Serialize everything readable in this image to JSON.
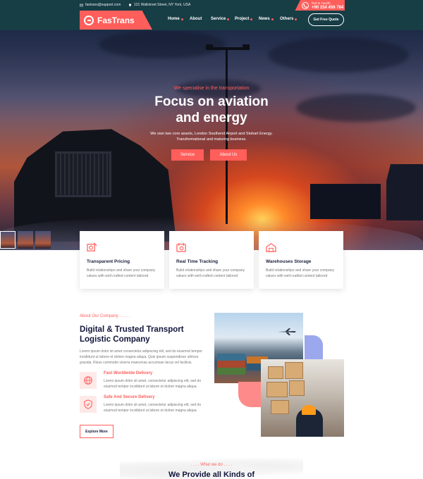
{
  "topbar": {
    "email": "fastrans@support.com",
    "address": "121 Wallstreet Street, NY York, USA",
    "call_label": "Get In Touch!",
    "phone": "+90 154 456 784"
  },
  "brand": {
    "name": "FasTrans",
    "color": "#ff5e5b"
  },
  "nav": {
    "items": [
      "Home",
      "About",
      "Service",
      "Project",
      "News",
      "Others"
    ],
    "quote_button": "Get Free Quote"
  },
  "hero": {
    "eyebrow": "We specialise in the transportation",
    "title_line1": "Focus on aviation",
    "title_line2": "and energy",
    "description": "We own two core assets, London Southend Airport and Stobart Energy. Transformational and maturing business.",
    "button_primary": "Service",
    "button_secondary": "About Us"
  },
  "features": [
    {
      "title": "Transparent Pricing",
      "text": "Build relationships and share your company values with well-crafted content tailored",
      "icon": "pricing-icon"
    },
    {
      "title": "Real Time Tracking",
      "text": "Build relationships and share your company values with well-crafted content tailored",
      "icon": "tracking-icon"
    },
    {
      "title": "Warehouses Storage",
      "text": "Build relationships and share your company values with well-crafted content tailored",
      "icon": "warehouse-icon"
    }
  ],
  "about": {
    "eyebrow": "About Our Company . . . . .",
    "title": "Digital & Trusted Transport Logistic Company",
    "text": "Lorem ipsum dolor sit amet consectetur adipiscing elit, sed do eiusmod tempor incididunt ut labore et dolore magna aliqua. Quis ipsum suspendisse ultrices gravida. Risus commodo viverra maecenas accumsan lacus vel facilisis.",
    "items": [
      {
        "title": "Fast Worldwide Delivery",
        "text": "Lorem ipsum dolor sit amet, consectetur adipiscing elit, sed do eiusmod tempor incididunt ut labore et dolore magna aliqua.",
        "icon": "globe-icon"
      },
      {
        "title": "Safe And Secure Delivery",
        "text": "Lorem ipsum dolor sit amet, consectetur adipiscing elit, sed do eiusmod tempor incididunt ut labore et dolore magna aliqua.",
        "icon": "shield-icon"
      }
    ],
    "button": "Explore More"
  },
  "what": {
    "eyebrow": ". . . . What we do . . . .",
    "title": "We Provide all Kinds of"
  }
}
